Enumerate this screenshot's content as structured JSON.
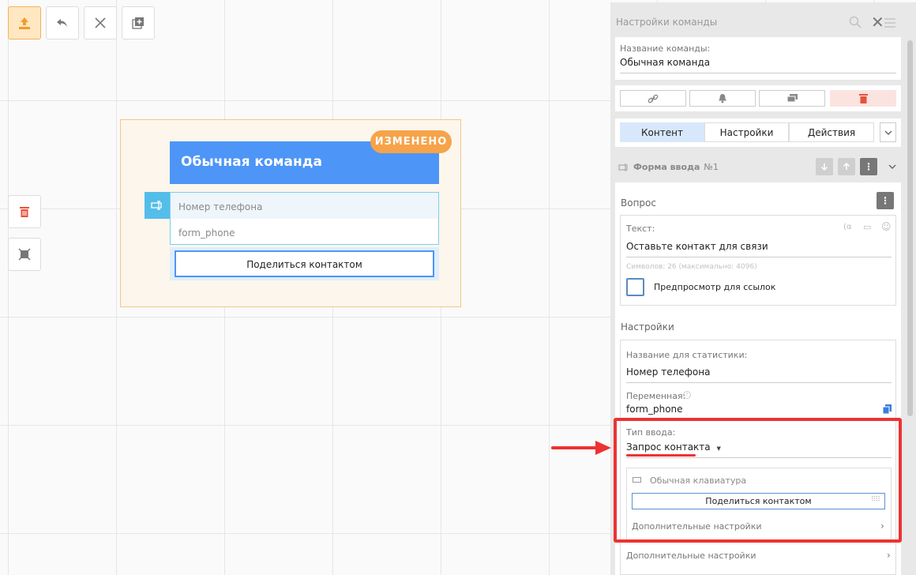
{
  "toolbar": {
    "publish": "upload-icon",
    "undo": "undo-icon",
    "close": "close-icon",
    "add": "add-icon"
  },
  "node": {
    "title": "Обычная команда",
    "badge": "ИЗМЕНЕНО",
    "form_placeholder": "Номер телефона",
    "form_variable": "form_phone",
    "contact_button": "Поделиться контактом"
  },
  "panel": {
    "title": "Настройки команды",
    "name_label": "Название команды:",
    "name_value": "Обычная команда",
    "tabs": [
      "Контент",
      "Настройки",
      "Действия"
    ],
    "form_header": "Форма ввода",
    "form_number": "№1",
    "question_label": "Вопрос",
    "text_label": "Текст:",
    "text_tools": "(α",
    "text_value": "Оставьте контакт для связи",
    "char_count": "Символов: 26 (максимально: 4096)",
    "preview_label": "Предпросмотр для ссылок",
    "settings_label": "Настройки",
    "stat_label": "Название для статистики:",
    "stat_value": "Номер телефона",
    "var_label": "Переменная:",
    "var_value": "form_phone",
    "input_type_label": "Тип ввода:",
    "input_type_value": "Запрос контакта",
    "keyboard_label": "Обычная клавиатура",
    "keyboard_button": "Поделиться контактом",
    "extra_settings_inner": "Дополнительные настройки",
    "extra_settings_outer": "Дополнительные настройки"
  },
  "colors": {
    "accent": "#4d95f7",
    "badge": "#f6a34a",
    "highlight": "#ee3232"
  }
}
